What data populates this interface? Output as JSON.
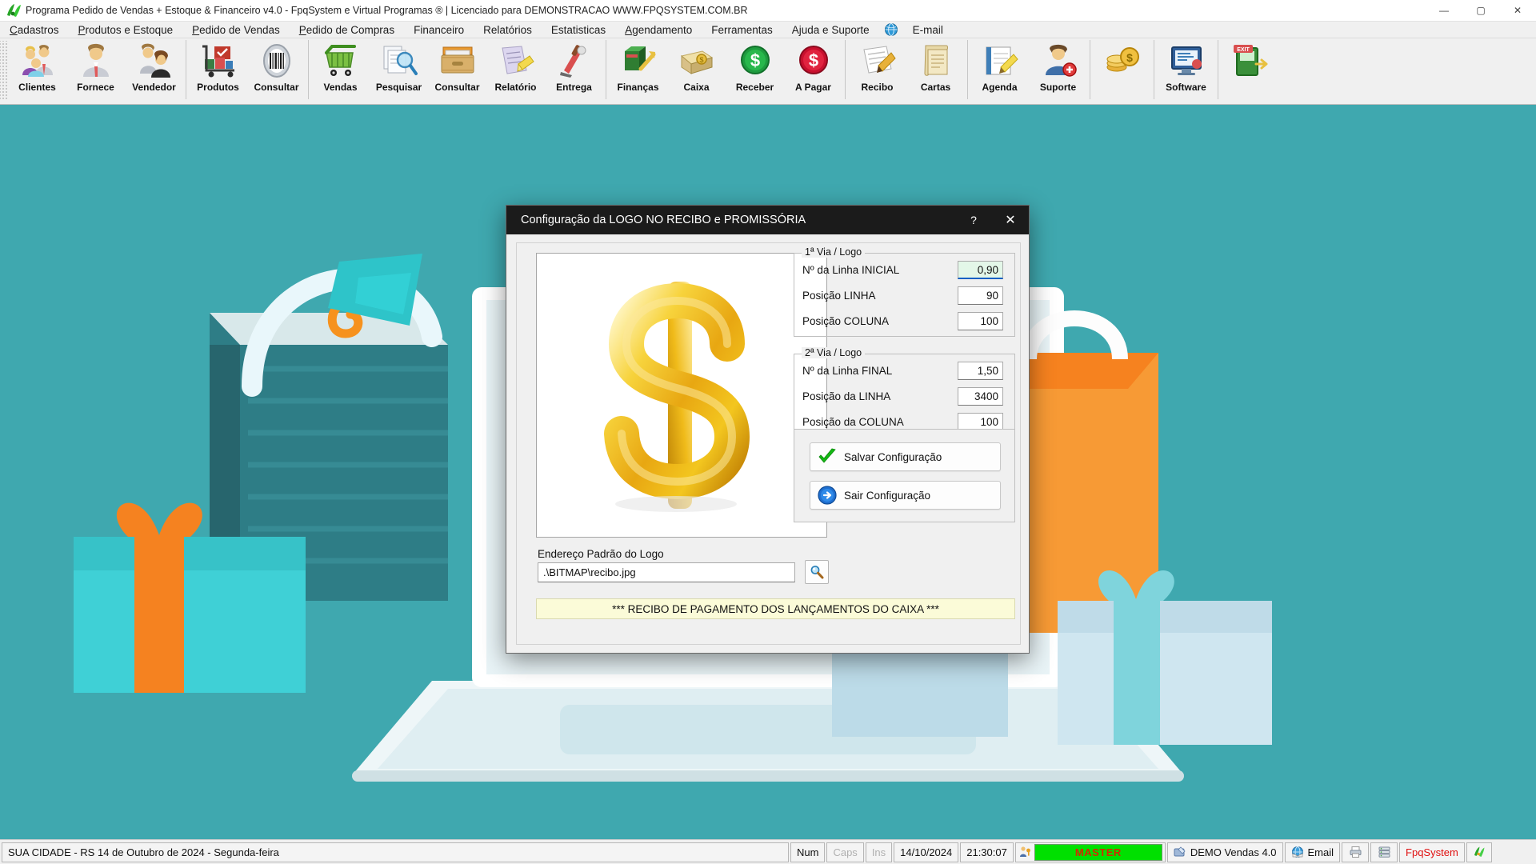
{
  "window": {
    "title": "Programa Pedido de Vendas + Estoque & Financeiro v4.0 - FpqSystem e Virtual Programas ® | Licenciado para  DEMONSTRACAO WWW.FPQSYSTEM.COM.BR",
    "minimize": "—",
    "maximize": "▢",
    "close": "✕",
    "app_icon": "butterfly-logo-icon"
  },
  "menubar": {
    "items": [
      {
        "label": "Cadastros",
        "accel": "C"
      },
      {
        "label": "Produtos e Estoque",
        "accel": "P"
      },
      {
        "label": "Pedido de Vendas",
        "accel": "P"
      },
      {
        "label": "Pedido de Compras",
        "accel": "P"
      },
      {
        "label": "Financeiro",
        "accel": ""
      },
      {
        "label": "Relatórios",
        "accel": ""
      },
      {
        "label": "Estatisticas",
        "accel": ""
      },
      {
        "label": "Agendamento",
        "accel": "A"
      },
      {
        "label": "Ferramentas",
        "accel": ""
      },
      {
        "label": "Ajuda e Suporte",
        "accel": ""
      },
      {
        "label": "E-mail",
        "accel": ""
      }
    ]
  },
  "toolbar": {
    "groups": [
      {
        "buttons": [
          {
            "label": "Clientes",
            "icon": "clients-group-icon"
          },
          {
            "label": "Fornece",
            "icon": "supplier-person-icon"
          },
          {
            "label": "Vendedor",
            "icon": "salesperson-pair-icon"
          }
        ]
      },
      {
        "buttons": [
          {
            "label": "Produtos",
            "icon": "product-cart-icon"
          },
          {
            "label": "Consultar",
            "icon": "barcode-icon"
          }
        ]
      },
      {
        "buttons": [
          {
            "label": "Vendas",
            "icon": "shopping-cart-icon"
          },
          {
            "label": "Pesquisar",
            "icon": "document-search-icon"
          },
          {
            "label": "Consultar",
            "icon": "file-box-icon"
          },
          {
            "label": "Relatório",
            "icon": "report-pencil-icon"
          },
          {
            "label": "Entrega",
            "icon": "delivery-truck-icon"
          }
        ]
      },
      {
        "buttons": [
          {
            "label": "Finanças",
            "icon": "finance-chart-icon"
          },
          {
            "label": "Caixa",
            "icon": "cash-register-icon"
          },
          {
            "label": "Receber",
            "icon": "money-in-icon"
          },
          {
            "label": "A Pagar",
            "icon": "money-out-icon"
          }
        ]
      },
      {
        "buttons": [
          {
            "label": "Recibo",
            "icon": "receipt-icon"
          },
          {
            "label": "Cartas",
            "icon": "letter-scroll-icon"
          }
        ]
      },
      {
        "buttons": [
          {
            "label": "Agenda",
            "icon": "agenda-notebook-icon"
          },
          {
            "label": "Suporte",
            "icon": "support-user-icon"
          }
        ]
      },
      {
        "buttons": [
          {
            "label": "",
            "icon": "coins-money-icon"
          }
        ]
      },
      {
        "buttons": [
          {
            "label": "Software",
            "icon": "software-monitor-icon"
          }
        ]
      },
      {
        "buttons": [
          {
            "label": "",
            "icon": "exit-door-icon"
          }
        ]
      }
    ]
  },
  "dialog": {
    "title": "Configuração da LOGO NO RECIBO e PROMISSÓRIA",
    "help_label": "?",
    "close_label": "✕",
    "preview_icon": "golden-dollar-sign-image",
    "address_label": "Endereço Padrão do Logo",
    "address_value": ".\\BITMAP\\recibo.jpg",
    "browse_icon": "magnifier-icon",
    "banner_text": "*** RECIBO DE PAGAMENTO DOS LANÇAMENTOS DO CAIXA ***",
    "group1": {
      "legend": "1ª Via / Logo",
      "fields": [
        {
          "label": "Nº da Linha INICIAL",
          "value": "0,90",
          "focused": true
        },
        {
          "label": "Posição LINHA",
          "value": "90",
          "focused": false
        },
        {
          "label": "Posição COLUNA",
          "value": "100",
          "focused": false
        }
      ]
    },
    "group2": {
      "legend": "2ª Via / Logo",
      "fields": [
        {
          "label": "Nº da Linha FINAL",
          "value": "1,50",
          "focused": false
        },
        {
          "label": "Posição da LINHA",
          "value": "3400",
          "focused": false
        },
        {
          "label": "Posição da COLUNA",
          "value": "100",
          "focused": false
        }
      ]
    },
    "buttons": [
      {
        "label": "Salvar Configuração",
        "icon": "green-check-icon"
      },
      {
        "label": "Sair Configuração",
        "icon": "blue-arrow-right-icon"
      }
    ]
  },
  "statusbar": {
    "location_text": "SUA CIDADE - RS 14 de Outubro de 2024 - Segunda-feira",
    "num": "Num",
    "caps": "Caps",
    "ins": "Ins",
    "date": "14/10/2024",
    "time": "21:30:07",
    "user_badge": "MASTER",
    "user_badge_color": "#00e000",
    "user_badge_text_color": "#d12b00",
    "module": "DEMO Vendas 4.0",
    "email": "Email",
    "brand": "FpqSystem",
    "icons": {
      "user": "user-key-icon",
      "module": "module-icon",
      "email": "email-globe-icon",
      "printer": "printer-icon",
      "server": "server-icon",
      "brand": "butterfly-logo-icon"
    }
  }
}
